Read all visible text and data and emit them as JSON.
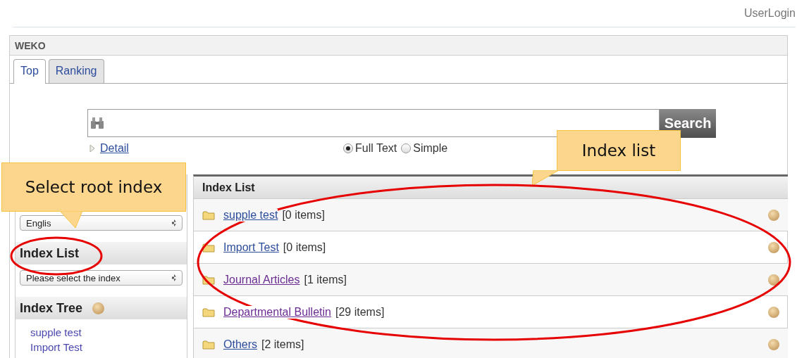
{
  "header": {
    "login_link": "UserLogin"
  },
  "site_title": "WEKO",
  "tabs": [
    {
      "label": "Top",
      "selected": true
    },
    {
      "label": "Ranking",
      "selected": false
    }
  ],
  "search": {
    "button": "Search",
    "detail_link": "Detail",
    "modes": [
      {
        "label": "Full Text",
        "selected": true
      },
      {
        "label": "Simple",
        "selected": false
      }
    ]
  },
  "sidebar": {
    "language_select": "Englis",
    "index_list_heading": "Index List",
    "index_select": "Please select the index",
    "index_tree_heading": "Index Tree",
    "tree_items": [
      {
        "label": "supple test"
      },
      {
        "label": "Import Test"
      }
    ]
  },
  "index_list": {
    "heading": "Index List",
    "rows": [
      {
        "name": "supple test",
        "count": "[0 items]",
        "visited": false
      },
      {
        "name": "Import Test",
        "count": "[0 items]",
        "visited": false
      },
      {
        "name": "Journal Articles",
        "count": "[1 items]",
        "visited": true
      },
      {
        "name": "Departmental Bulletin",
        "count": "[29 items]",
        "visited": true
      },
      {
        "name": "Others",
        "count": "[2 items]",
        "visited": false
      }
    ]
  },
  "callouts": [
    {
      "text": "Index list"
    },
    {
      "text": "Select root index"
    }
  ]
}
